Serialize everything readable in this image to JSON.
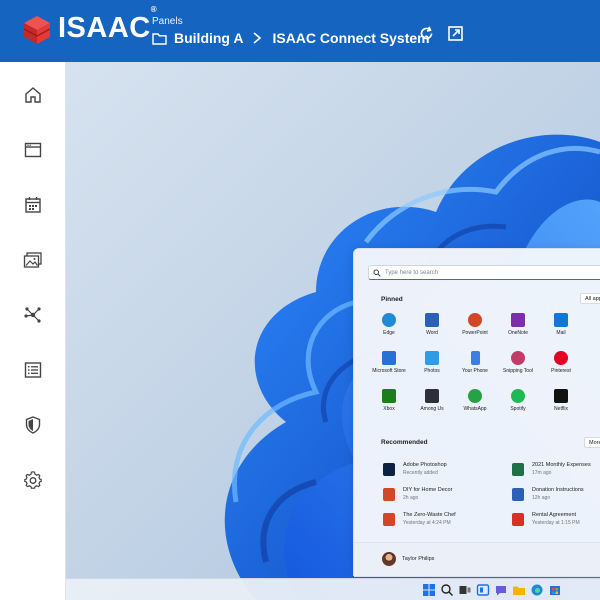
{
  "header": {
    "brand": "ISAAC",
    "panels_label": "Panels",
    "breadcrumb": [
      "Building A",
      "ISAAC Connect System"
    ]
  },
  "colors": {
    "header_bg": "#1565c0",
    "logo_red": "#d32f2f",
    "accent": "#1a73e8"
  },
  "sidebar": {
    "items": [
      {
        "name": "home",
        "icon": "home-icon"
      },
      {
        "name": "browser",
        "icon": "browser-window-icon"
      },
      {
        "name": "calendar",
        "icon": "calendar-icon"
      },
      {
        "name": "media",
        "icon": "image-gallery-icon"
      },
      {
        "name": "network",
        "icon": "network-nodes-icon"
      },
      {
        "name": "list",
        "icon": "list-icon"
      },
      {
        "name": "security",
        "icon": "shield-icon"
      },
      {
        "name": "settings",
        "icon": "gear-icon"
      }
    ]
  },
  "start_menu": {
    "search_placeholder": "Type here to search",
    "pinned_title": "Pinned",
    "all_apps": "All apps",
    "pinned": [
      {
        "label": "Edge",
        "color": "#1f8ad6"
      },
      {
        "label": "Word",
        "color": "#2b5fb8"
      },
      {
        "label": "PowerPoint",
        "color": "#d24726"
      },
      {
        "label": "OneNote",
        "color": "#7b2fa8"
      },
      {
        "label": "Mail",
        "color": "#0f78d4"
      },
      {
        "label": "Microsoft Store",
        "color": "#2a6fd6"
      },
      {
        "label": "Photos",
        "color": "#2f9ce8"
      },
      {
        "label": "Your Phone",
        "color": "#3b7de0"
      },
      {
        "label": "Snipping Tool",
        "color": "#c23b6b"
      },
      {
        "label": "Pinterest",
        "color": "#e60023"
      },
      {
        "label": "Xbox",
        "color": "#1a7f1a"
      },
      {
        "label": "Among Us",
        "color": "#2f2f3a"
      },
      {
        "label": "WhatsApp",
        "color": "#25a244"
      },
      {
        "label": "Spotify",
        "color": "#1db954"
      },
      {
        "label": "Netflix",
        "color": "#111111"
      }
    ],
    "recommended_title": "Recommended",
    "more": "More",
    "recommended": [
      {
        "name": "Adobe Photoshop",
        "time": "Recently added",
        "color": "#0b2240"
      },
      {
        "name": "2021 Monthly Expenses",
        "time": "17m ago",
        "color": "#1e7145"
      },
      {
        "name": "DIY for Home Decor",
        "time": "2h ago",
        "color": "#d24726"
      },
      {
        "name": "Donation Instructions",
        "time": "12h ago",
        "color": "#2b5fb8"
      },
      {
        "name": "The Zero-Waste Chef",
        "time": "Yesterday at 4:24 PM",
        "color": "#d24726"
      },
      {
        "name": "Rental Agreement",
        "time": "Yesterday at 1:15 PM",
        "color": "#d93025"
      }
    ],
    "user_name": "Taylor Philips"
  },
  "taskbar": {
    "icons": [
      "windows-start-icon",
      "search-icon",
      "task-view-icon",
      "widgets-icon",
      "chat-icon",
      "file-explorer-icon",
      "edge-icon",
      "store-icon"
    ]
  }
}
